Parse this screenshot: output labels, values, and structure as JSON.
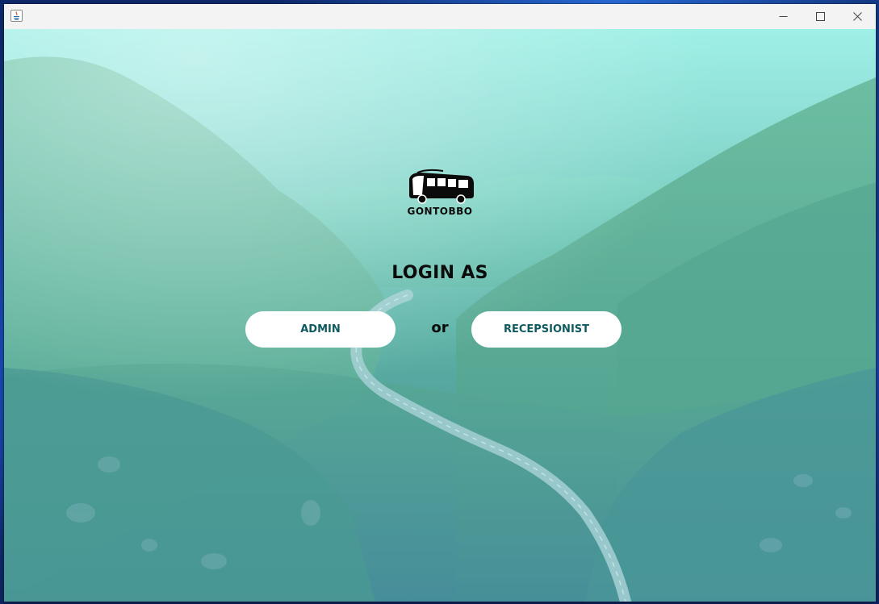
{
  "window": {
    "title": "",
    "controls": [
      "minimize",
      "maximize",
      "close"
    ]
  },
  "brand": {
    "name": "GONTOBBO",
    "icon": "bus-icon"
  },
  "login": {
    "heading": "LOGIN AS",
    "separator": "or",
    "admin_label": "ADMIN",
    "receptionist_label": "RECEPSIONIST"
  },
  "colors": {
    "button_bg": "#ffffff",
    "button_text": "#0e5a5f",
    "heading_text": "#0b0b0b"
  }
}
